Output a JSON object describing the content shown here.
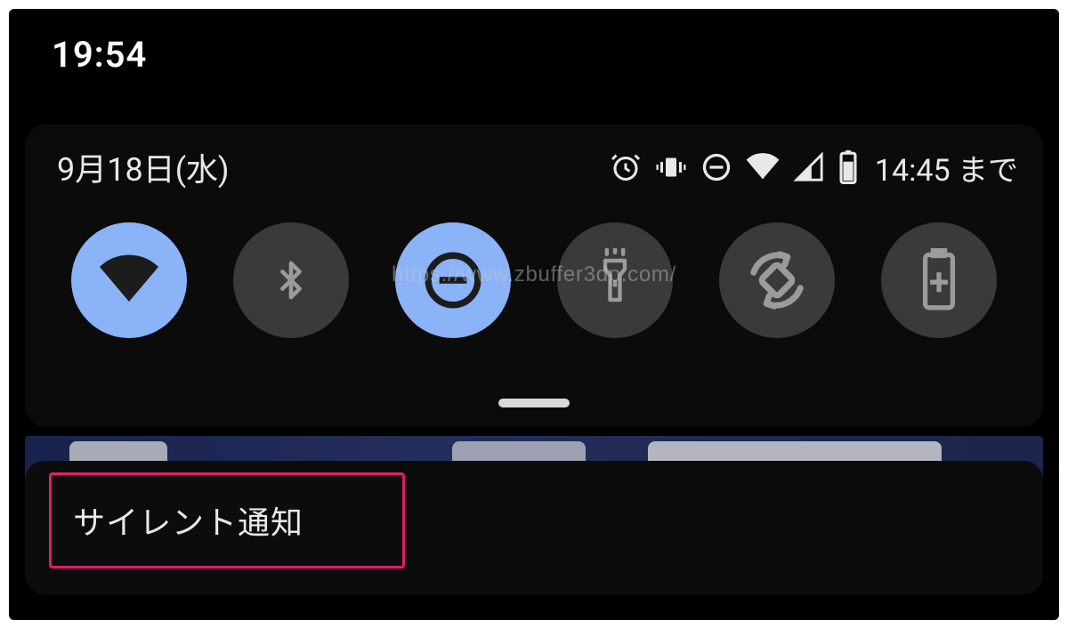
{
  "clock": "19:54",
  "panel": {
    "date": "9月18日(水)",
    "battery_time": "14:45 まで"
  },
  "tiles": {
    "wifi": {
      "active": true
    },
    "bluetooth": {
      "active": false
    },
    "dnd": {
      "active": true
    },
    "flashlight": {
      "active": false
    },
    "autorotate": {
      "active": false
    },
    "battery_saver": {
      "active": false
    }
  },
  "notification": {
    "silent_label": "サイレント通知"
  },
  "watermark": "https://www.zbuffer3dp.com/"
}
